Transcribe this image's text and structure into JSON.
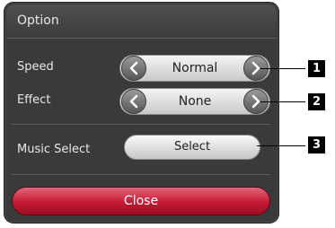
{
  "dialog": {
    "title": "Option",
    "rows": [
      {
        "label": "Speed",
        "value": "Normal"
      },
      {
        "label": "Effect",
        "value": "None"
      }
    ],
    "music_select": {
      "label": "Music Select",
      "button": "Select"
    },
    "close_button": "Close"
  },
  "callouts": [
    "1",
    "2",
    "3"
  ],
  "colors": {
    "panel": "#3a3a3a",
    "close_button": "#c41a34",
    "callout_badge": "#000000"
  },
  "icons": {
    "left_arrow": "chevron-left-icon",
    "right_arrow": "chevron-right-icon"
  }
}
